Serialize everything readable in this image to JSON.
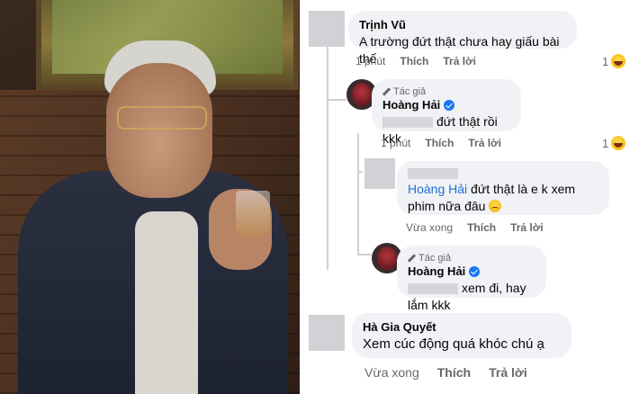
{
  "comments": [
    {
      "id": "c1",
      "name": "Trịnh Vũ",
      "text": "A trường đứt thật chưa hay giấu bài thế",
      "time": "1 phút",
      "like": "Thích",
      "reply": "Trả lời",
      "reaction_count": "1"
    },
    {
      "id": "c1r1",
      "author_tag": "Tác giả",
      "name": "Hoàng Hải",
      "text": "đứt thật rồi kkk",
      "time": "1 phút",
      "like": "Thích",
      "reply": "Trả lời",
      "reaction_count": "1"
    },
    {
      "id": "c1r2",
      "mention": "Hoàng Hải",
      "text": " đứt thật là e k xem phim nữa đâu",
      "time": "Vừa xong",
      "like": "Thích",
      "reply": "Trả lời"
    },
    {
      "id": "c1r3",
      "author_tag": "Tác giả",
      "name": "Hoàng Hải",
      "text": "xem đi, hay lắm kkk"
    },
    {
      "id": "c2",
      "name": "Hà Gia Quyết",
      "text": "Xem cúc động quá khóc chú ạ",
      "time": "Vừa xong",
      "like": "Thích",
      "reply": "Trả lời"
    }
  ]
}
